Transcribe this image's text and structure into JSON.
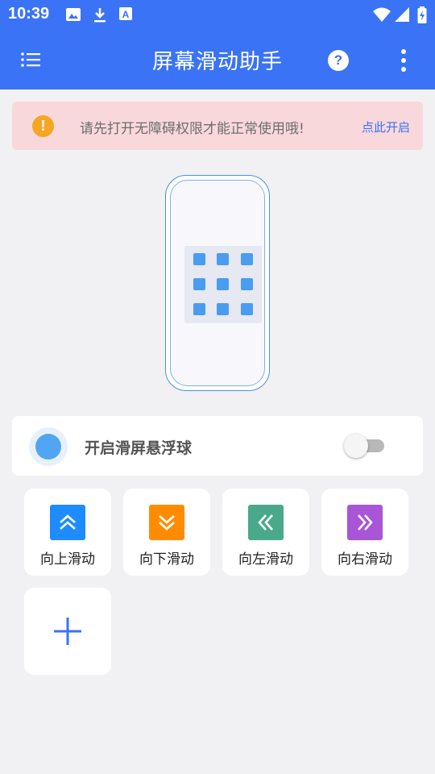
{
  "status": {
    "time": "10:39"
  },
  "appbar": {
    "title": "屏幕滑动助手",
    "help_label": "?"
  },
  "alert": {
    "message": "请先打开无障碍权限才能正常使用哦!",
    "action": "点此开启",
    "icon_text": "!"
  },
  "float": {
    "label": "开启滑屏悬浮球",
    "enabled": false
  },
  "actions": [
    {
      "label": "向上滑动",
      "color": "#1e8bff",
      "icon": "double-chevron-up-icon"
    },
    {
      "label": "向下滑动",
      "color": "#ff8c00",
      "icon": "double-chevron-down-icon"
    },
    {
      "label": "向左滑动",
      "color": "#4aa98a",
      "icon": "double-chevron-left-icon"
    },
    {
      "label": "向右滑动",
      "color": "#a855d8",
      "icon": "double-chevron-right-icon"
    }
  ],
  "colors": {
    "primary": "#3a73f5",
    "alert_bg": "#f8d8da",
    "warning": "#f5a623"
  }
}
